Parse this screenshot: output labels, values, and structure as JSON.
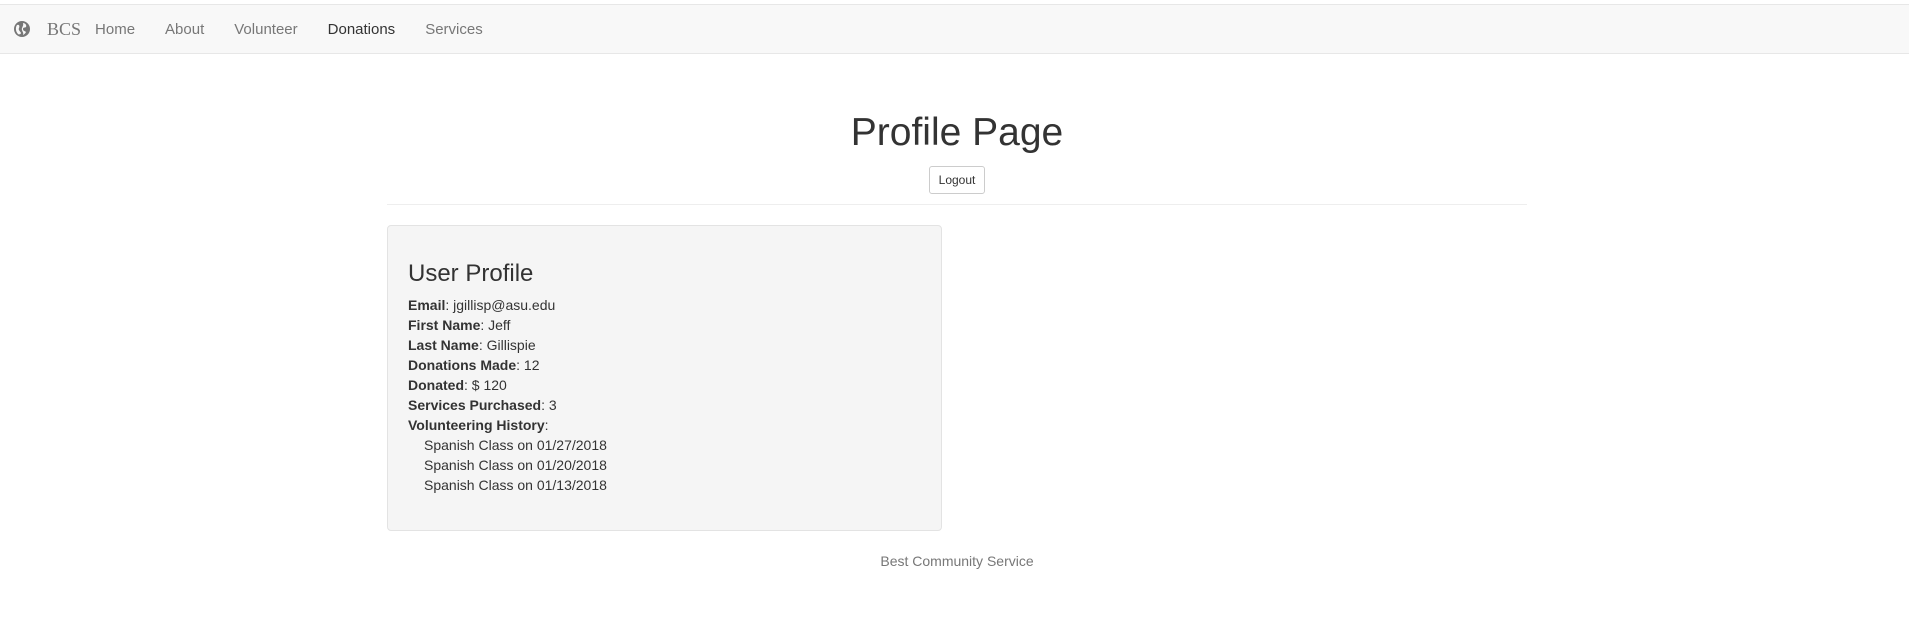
{
  "navbar": {
    "brand_icon": "globe-icon",
    "brand": "BCS",
    "links": [
      {
        "label": "Home",
        "active": false
      },
      {
        "label": "About",
        "active": false
      },
      {
        "label": "Volunteer",
        "active": false
      },
      {
        "label": "Donations",
        "active": true
      },
      {
        "label": "Services",
        "active": false
      }
    ]
  },
  "header": {
    "title": "Profile Page",
    "logout_label": "Logout"
  },
  "profile": {
    "heading": "User Profile",
    "fields": [
      {
        "label": "Email",
        "value": ": jgillisp@asu.edu"
      },
      {
        "label": "First Name",
        "value": ": Jeff"
      },
      {
        "label": "Last Name",
        "value": ": Gillispie"
      },
      {
        "label": "Donations Made",
        "value": ": 12"
      },
      {
        "label": "Donated",
        "value": ": $ 120"
      },
      {
        "label": "Services Purchased",
        "value": ": 3"
      },
      {
        "label": "Volunteering History",
        "value": ":"
      }
    ],
    "history": [
      "Spanish Class on 01/27/2018",
      "Spanish Class on 01/20/2018",
      "Spanish Class on 01/13/2018"
    ]
  },
  "footer": {
    "text": "Best Community Service"
  },
  "colors": {
    "navbar_bg": "#f8f8f8",
    "well_bg": "#f5f5f5",
    "link_muted": "#777777",
    "text": "#333333"
  }
}
